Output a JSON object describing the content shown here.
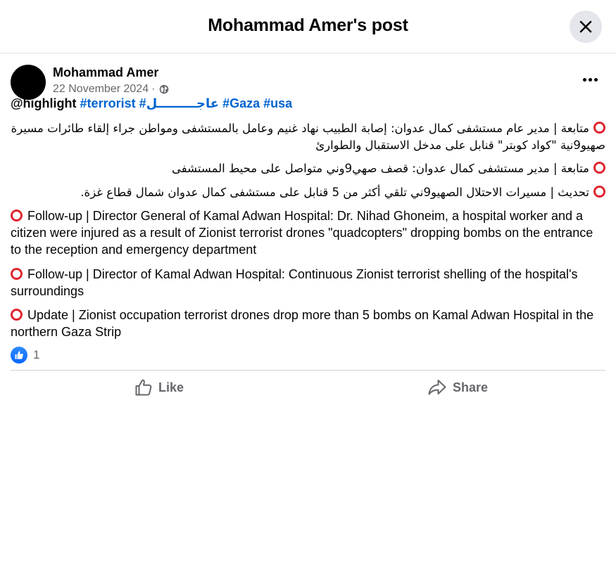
{
  "dialog": {
    "title": "Mohammad Amer's post"
  },
  "post": {
    "author": "Mohammad Amer",
    "date": "22 November 2024",
    "meta_separator": "·",
    "mention": "@highlight",
    "hashtags": [
      "#terrorist",
      "#عاجـــــــــل",
      "#Gaza",
      "#usa"
    ],
    "arabic_lines": [
      "متابعة | مدير عام مستشفى كمال عدوان: إصابة الطبيب نهاد غنيم وعامل بالمستشفى ومواطن جراء إلقاء طائرات مسيرة صهيو9نية  \"كواد كوبتر\" قنابل على مدخل الاستقبال والطوارئ",
      "متابعة  | مدير مستشفى كمال عدوان: قصف صهي9وني متواصل على محيط المستشفى",
      "تحديث | مسيرات الاحتلال الصهيو9ني تلقي أكثر من 5 قنابل على مستشفى كمال عدوان شمال قطاع غزة."
    ],
    "english_paragraphs": [
      "Follow-up | Director General of Kamal Adwan Hospital: Dr. Nihad Ghoneim, a hospital worker and a citizen were injured as a result of Zionist terrorist drones \"quadcopters\" dropping bombs on the entrance to the reception and emergency department",
      "Follow-up | Director of Kamal Adwan Hospital: Continuous Zionist terrorist shelling of the hospital's surroundings",
      "Update | Zionist occupation terrorist drones drop more than 5 bombs on Kamal Adwan Hospital in the northern Gaza Strip"
    ],
    "reaction_count": "1"
  },
  "actions": {
    "like_label": "Like",
    "share_label": "Share"
  },
  "colors": {
    "accent_blue": "#0064d1",
    "circle_red": "#e0252f",
    "muted": "#65676b"
  }
}
